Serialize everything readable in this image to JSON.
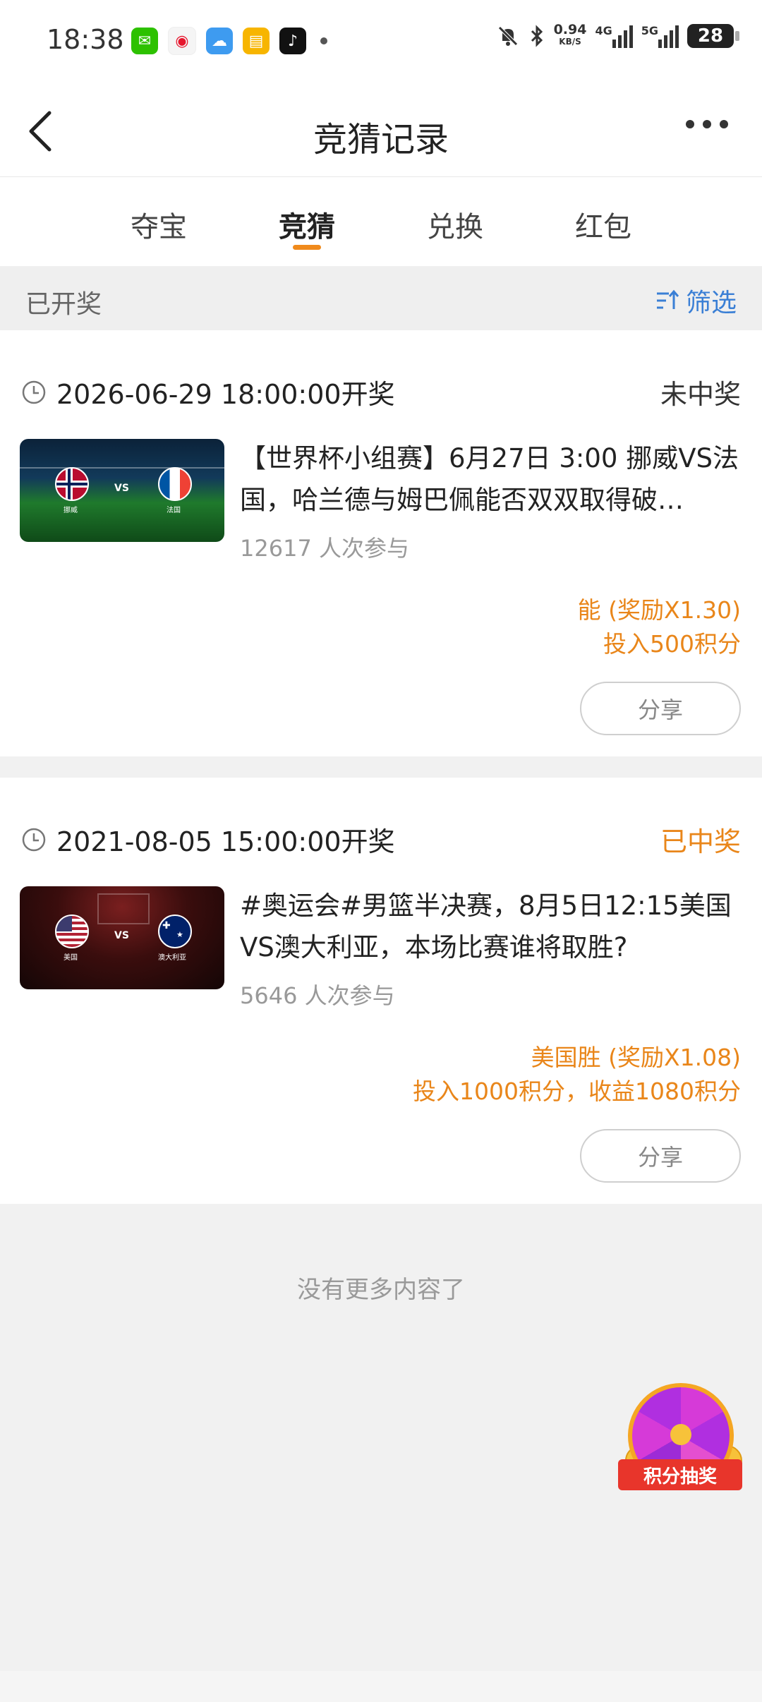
{
  "status_bar": {
    "time": "18:38",
    "net_speed_value": "0.94",
    "net_speed_unit": "KB/S",
    "signal1_label": "4G",
    "signal2_label": "5G",
    "battery": "28",
    "app_icons": [
      "wechat-icon",
      "weibo-icon",
      "weather-icon",
      "notes-icon",
      "tiktok-icon"
    ]
  },
  "nav": {
    "title": "竞猜记录"
  },
  "tabs": [
    {
      "label": "夺宝"
    },
    {
      "label": "竞猜"
    },
    {
      "label": "兑换"
    },
    {
      "label": "红包"
    }
  ],
  "filter": {
    "section_label": "已开奖",
    "filter_label": "筛选"
  },
  "records": [
    {
      "draw_time": "2026-06-29 18:00:00开奖",
      "status": "未中奖",
      "title": "【世界杯小组赛】6月27日 3:00 挪威VS法国，哈兰德与姆巴佩能否双双取得破…",
      "participants": "12617 人次参与",
      "bet_choice": "能 (奖励X1.30)",
      "bet_amount": "投入500积分",
      "share_label": "分享",
      "thumb": {
        "team_a": "挪威",
        "team_b": "法国",
        "vs": "VS"
      }
    },
    {
      "draw_time": "2021-08-05 15:00:00开奖",
      "status": "已中奖",
      "title": "#奥运会#男篮半决赛，8月5日12:15美国VS澳大利亚，本场比赛谁将取胜?",
      "participants": "5646 人次参与",
      "bet_choice": "美国胜 (奖励X1.08)",
      "bet_amount": "投入1000积分，收益1080积分",
      "share_label": "分享",
      "thumb": {
        "team_a": "美国",
        "team_b": "澳大利亚",
        "vs": "VS"
      }
    }
  ],
  "footer": {
    "no_more": "没有更多内容了"
  },
  "lottery_button": {
    "label": "积分抽奖"
  },
  "colors": {
    "accent": "#e9861a",
    "link": "#3a7fd5",
    "background": "#f1f1f1"
  }
}
